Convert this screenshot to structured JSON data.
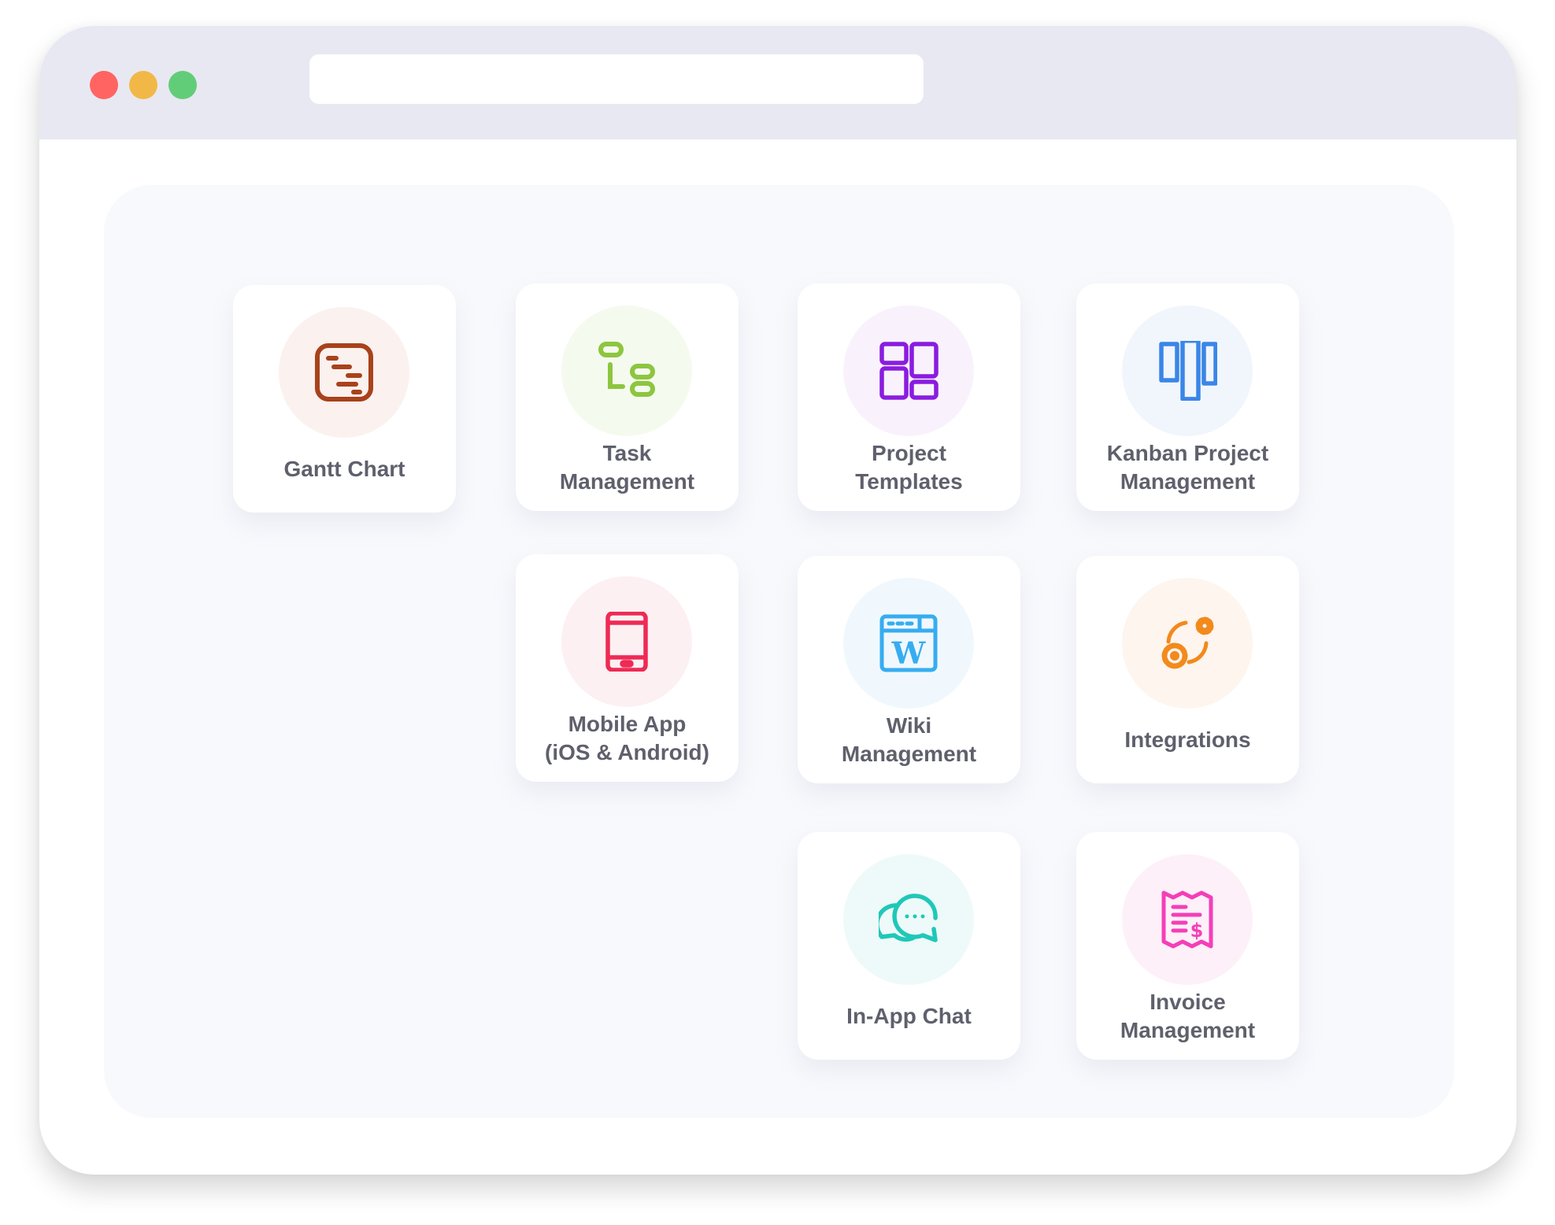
{
  "window": {
    "controls": [
      "close",
      "minimize",
      "maximize"
    ],
    "address_bar": {
      "value": "",
      "placeholder": ""
    }
  },
  "features": [
    {
      "id": "gantt-chart",
      "lines": [
        "Gantt Chart"
      ],
      "icon": "gantt-chart-icon",
      "color": "#a8421b",
      "tint": "#fbf1ee"
    },
    {
      "id": "task-management",
      "lines": [
        "Task",
        "Management"
      ],
      "icon": "task-list-icon",
      "color": "#8cc63f",
      "tint": "#f5faee"
    },
    {
      "id": "project-templates",
      "lines": [
        "Project",
        "Templates"
      ],
      "icon": "templates-grid-icon",
      "color": "#8a1ce0",
      "tint": "#f9f2fc"
    },
    {
      "id": "kanban-project-management",
      "lines": [
        "Kanban Project",
        "Management"
      ],
      "icon": "kanban-board-icon",
      "color": "#3a86e8",
      "tint": "#f1f6fd"
    },
    {
      "id": "mobile-app",
      "lines": [
        "Mobile App",
        "(iOS & Android)"
      ],
      "icon": "smartphone-icon",
      "color": "#ee2a55",
      "tint": "#fdf0f2"
    },
    {
      "id": "wiki-management",
      "lines": [
        "Wiki",
        "Management"
      ],
      "icon": "wiki-browser-icon",
      "color": "#36adf0",
      "tint": "#f0f8fd"
    },
    {
      "id": "integrations",
      "lines": [
        "Integrations"
      ],
      "icon": "integration-gears-icon",
      "color": "#f28a1c",
      "tint": "#fdf5ee"
    },
    {
      "id": "in-app-chat",
      "lines": [
        "In-App Chat"
      ],
      "icon": "chat-bubbles-icon",
      "color": "#1fc8b8",
      "tint": "#eefaf9"
    },
    {
      "id": "invoice-management",
      "lines": [
        "Invoice",
        "Management"
      ],
      "icon": "invoice-receipt-icon",
      "color": "#f43fb8",
      "tint": "#fdf0f8"
    }
  ]
}
